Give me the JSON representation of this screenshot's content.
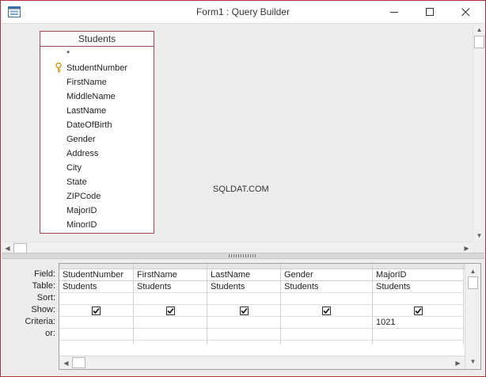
{
  "window": {
    "title": "Form1 : Query Builder"
  },
  "table_pane": {
    "table_name": "Students",
    "fields": [
      {
        "label": "*",
        "primary_key": false
      },
      {
        "label": "StudentNumber",
        "primary_key": true
      },
      {
        "label": "FirstName",
        "primary_key": false
      },
      {
        "label": "MiddleName",
        "primary_key": false
      },
      {
        "label": "LastName",
        "primary_key": false
      },
      {
        "label": "DateOfBirth",
        "primary_key": false
      },
      {
        "label": "Gender",
        "primary_key": false
      },
      {
        "label": "Address",
        "primary_key": false
      },
      {
        "label": "City",
        "primary_key": false
      },
      {
        "label": "State",
        "primary_key": false
      },
      {
        "label": "ZIPCode",
        "primary_key": false
      },
      {
        "label": "MajorID",
        "primary_key": false
      },
      {
        "label": "MinorID",
        "primary_key": false
      }
    ],
    "watermark": "SQLDAT.COM"
  },
  "design_grid": {
    "row_labels": {
      "field": "Field:",
      "table": "Table:",
      "sort": "Sort:",
      "show": "Show:",
      "criteria": "Criteria:",
      "or": "or:"
    },
    "columns": [
      {
        "field": "StudentNumber",
        "table": "Students",
        "sort": "",
        "show": true,
        "criteria": "",
        "or": ""
      },
      {
        "field": "FirstName",
        "table": "Students",
        "sort": "",
        "show": true,
        "criteria": "",
        "or": ""
      },
      {
        "field": "LastName",
        "table": "Students",
        "sort": "",
        "show": true,
        "criteria": "",
        "or": ""
      },
      {
        "field": "Gender",
        "table": "Students",
        "sort": "",
        "show": true,
        "criteria": "",
        "or": ""
      },
      {
        "field": "MajorID",
        "table": "Students",
        "sort": "",
        "show": true,
        "criteria": "1021",
        "or": ""
      },
      {
        "field": "",
        "table": "",
        "sort": "",
        "show": false,
        "criteria": "",
        "or": ""
      }
    ]
  },
  "colors": {
    "window_border": "#b0303a",
    "table_border": "#a84a55",
    "key_icon": "#c9a227"
  }
}
